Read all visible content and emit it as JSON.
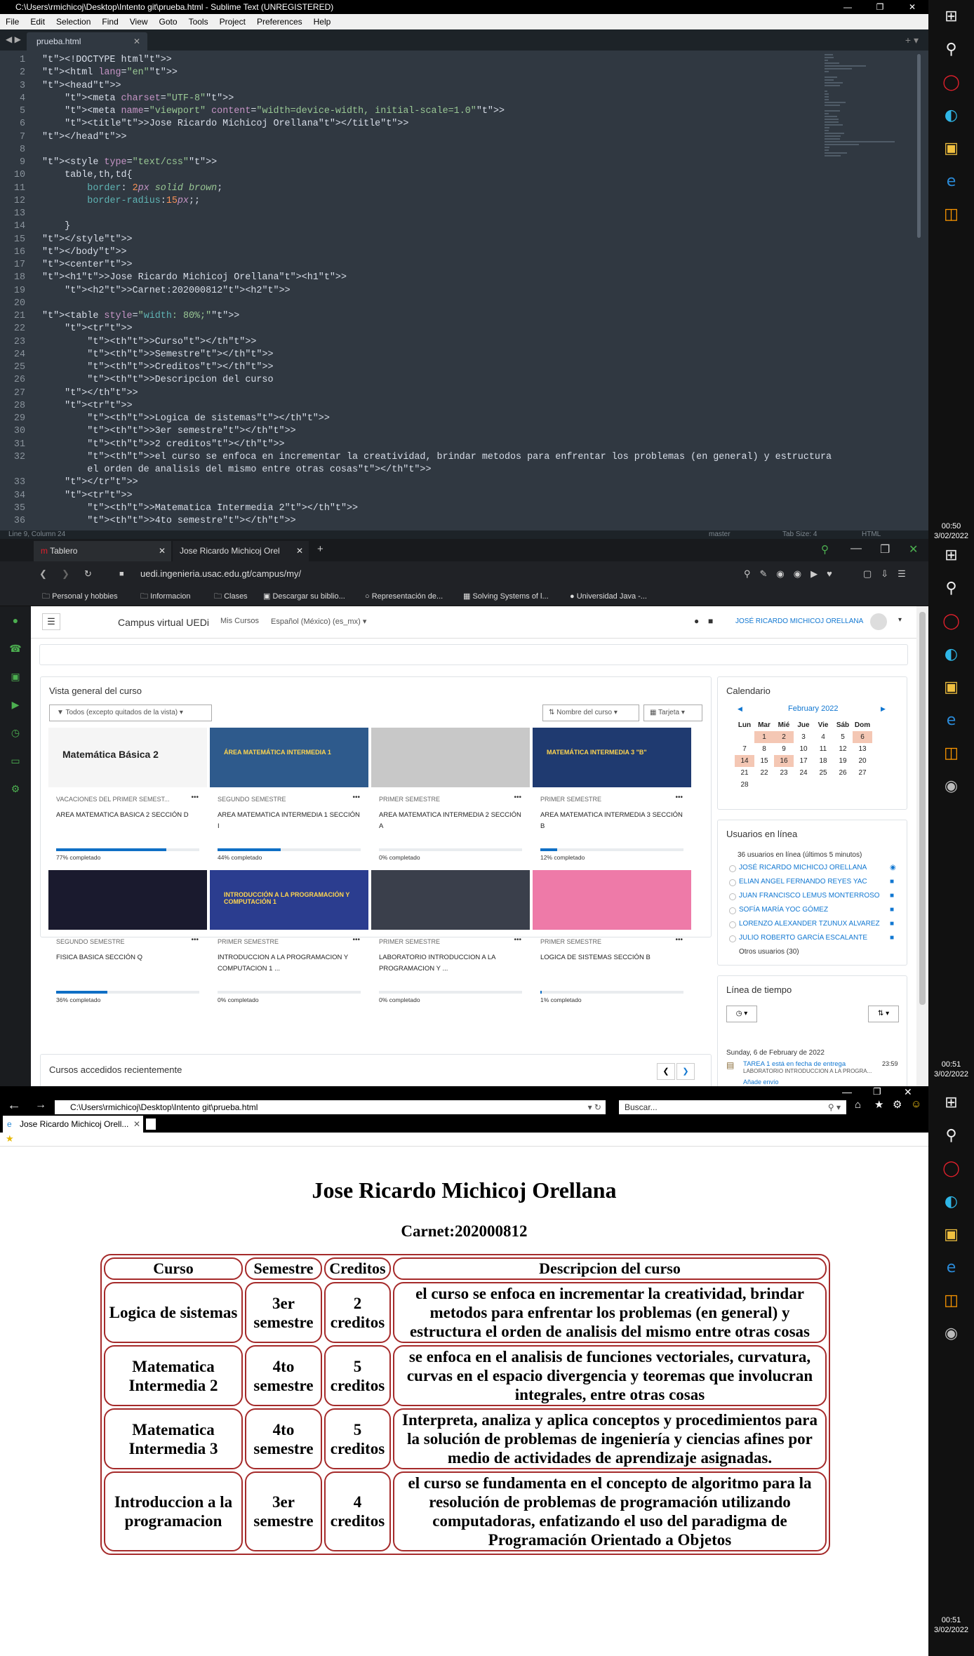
{
  "sublime": {
    "title": "C:\\Users\\rmichicoj\\Desktop\\Intento git\\prueba.html - Sublime Text (UNREGISTERED)",
    "menu": [
      "File",
      "Edit",
      "Selection",
      "Find",
      "View",
      "Goto",
      "Tools",
      "Project",
      "Preferences",
      "Help"
    ],
    "tab": "prueba.html",
    "status_left": "Line 9, Column 24",
    "status_branch": "master",
    "status_tab": "Tab Size: 4",
    "status_syntax": "HTML",
    "code_lines": [
      {
        "n": "1",
        "t": "<!DOCTYPE html>"
      },
      {
        "n": "2",
        "t": "<html lang=\"en\">"
      },
      {
        "n": "3",
        "t": "<head>"
      },
      {
        "n": "4",
        "t": "    <meta charset=\"UTF-8\">"
      },
      {
        "n": "5",
        "t": "    <meta name=\"viewport\" content=\"width=device-width, initial-scale=1.0\">"
      },
      {
        "n": "6",
        "t": "    <title>Jose Ricardo Michicoj Orellana</title>"
      },
      {
        "n": "7",
        "t": "</head>"
      },
      {
        "n": "8",
        "t": ""
      },
      {
        "n": "9",
        "t": "<style type=\"text/css\">"
      },
      {
        "n": "10",
        "t": "    table,th,td{"
      },
      {
        "n": "11",
        "t": "        border: 2px solid brown;"
      },
      {
        "n": "12",
        "t": "        border-radius:15px;;"
      },
      {
        "n": "13",
        "t": ""
      },
      {
        "n": "14",
        "t": "    }"
      },
      {
        "n": "15",
        "t": "</style>"
      },
      {
        "n": "16",
        "t": "</body>"
      },
      {
        "n": "17",
        "t": "<center>"
      },
      {
        "n": "18",
        "t": "<h1>Jose Ricardo Michicoj Orellana<h1>"
      },
      {
        "n": "19",
        "t": "    <h2>Carnet:202000812<h2>"
      },
      {
        "n": "20",
        "t": ""
      },
      {
        "n": "21",
        "t": "<table style=\"width: 80%;\">"
      },
      {
        "n": "22",
        "t": "    <tr>"
      },
      {
        "n": "23",
        "t": "        <th>Curso</th>"
      },
      {
        "n": "24",
        "t": "        <th>Semestre</th>"
      },
      {
        "n": "25",
        "t": "        <th>Creditos</th>"
      },
      {
        "n": "26",
        "t": "        <th>Descripcion del curso"
      },
      {
        "n": "27",
        "t": "    </th>"
      },
      {
        "n": "28",
        "t": "    <tr>"
      },
      {
        "n": "29",
        "t": "        <th>Logica de sistemas</th>"
      },
      {
        "n": "30",
        "t": "        <th>3er semestre</th>"
      },
      {
        "n": "31",
        "t": "        <th>2 creditos</th>"
      },
      {
        "n": "32",
        "t": "        <th>el curso se enfoca en incrementar la creatividad, brindar metodos para enfrentar los problemas (en general) y estructura"
      },
      {
        "n": "",
        "t": "        el orden de analisis del mismo entre otras cosas</th>"
      },
      {
        "n": "33",
        "t": "    </tr>"
      },
      {
        "n": "34",
        "t": "    <tr>"
      },
      {
        "n": "35",
        "t": "        <th>Matematica Intermedia 2</th>"
      },
      {
        "n": "36",
        "t": "        <th>4to semestre</th>"
      }
    ]
  },
  "taskbar": {
    "clock1_time": "00:50",
    "clock1_date": "3/02/2022",
    "clock2_time": "00:51",
    "clock2_date": "3/02/2022",
    "clock3_time": "00:51",
    "clock3_date": "3/02/2022"
  },
  "moodle_browser": {
    "tab1": "Tablero",
    "tab2": "Jose Ricardo Michicoj Orel",
    "url": "uedi.ingenieria.usac.edu.gt/campus/my/",
    "bookmarks": [
      "Personal y hobbies",
      "Informacion",
      "Clases",
      "Descargar su biblio...",
      "Representación de...",
      "Solving Systems of l...",
      "Universidad Java -..."
    ],
    "site_name": "Campus virtual UEDi",
    "nav_my_courses": "Mis Cursos",
    "nav_lang": "Español (México) (es_mx)",
    "user_name": "JOSÉ RICARDO MICHICOJ ORELLANA",
    "overview_title": "Vista general del curso",
    "filter_label": "Todos (excepto quitados de la vista)",
    "sort_label": "Nombre del curso",
    "view_label": "Tarjeta",
    "courses": [
      {
        "cat": "VACACIONES DEL PRIMER SEMEST...",
        "name": "AREA MATEMATICA BASICA 2 Sección D",
        "progress": "77% completado",
        "pct": 77,
        "img": "Matemática Básica 2"
      },
      {
        "cat": "SEGUNDO SEMESTRE",
        "name": "AREA MATEMATICA INTERMEDIA 1 Sección I",
        "progress": "44% completado",
        "pct": 44,
        "img": "ÁREA MATEMÁTICA INTERMEDIA 1"
      },
      {
        "cat": "PRIMER SEMESTRE",
        "name": "AREA MATEMATICA INTERMEDIA 2 Sección A",
        "progress": "0% completado",
        "pct": 0,
        "img": ""
      },
      {
        "cat": "PRIMER SEMESTRE",
        "name": "AREA MATEMATICA INTERMEDIA 3 Sección B",
        "progress": "12% completado",
        "pct": 12,
        "img": "MATEMÁTICA INTERMEDIA 3 \"B\""
      },
      {
        "cat": "SEGUNDO SEMESTRE",
        "name": "FISICA BASICA Sección Q",
        "progress": "36% completado",
        "pct": 36,
        "img": ""
      },
      {
        "cat": "PRIMER SEMESTRE",
        "name": "INTRODUCCION A LA PROGRAMACION Y COMPUTACION 1 ...",
        "progress": "0% completado",
        "pct": 0,
        "img": "INTRODUCCIÓN A LA PROGRAMACIÓN Y COMPUTACIÓN 1"
      },
      {
        "cat": "PRIMER SEMESTRE",
        "name": "LABORATORIO INTRODUCCION A LA PROGRAMACION Y ...",
        "progress": "0% completado",
        "pct": 0,
        "img": ""
      },
      {
        "cat": "PRIMER SEMESTRE",
        "name": "LOGICA DE SISTEMAS Sección B",
        "progress": "1% completado",
        "pct": 1,
        "img": ""
      }
    ],
    "recent_title": "Cursos accedidos recientemente",
    "calendar": {
      "title": "Calendario",
      "month": "February 2022",
      "days": [
        "Lun",
        "Mar",
        "Mié",
        "Jue",
        "Vie",
        "Sáb",
        "Dom"
      ],
      "weeks": [
        [
          "",
          "1",
          "2",
          "3",
          "4",
          "5",
          "6"
        ],
        [
          "7",
          "8",
          "9",
          "10",
          "11",
          "12",
          "13"
        ],
        [
          "14",
          "15",
          "16",
          "17",
          "18",
          "19",
          "20"
        ],
        [
          "21",
          "22",
          "23",
          "24",
          "25",
          "26",
          "27"
        ],
        [
          "28",
          "",
          "",
          "",
          "",
          "",
          ""
        ]
      ]
    },
    "online": {
      "title": "Usuarios en línea",
      "summary": "36 usuarios en línea (últimos 5 minutos)",
      "users": [
        "JOSÉ RICARDO MICHICOJ ORELLANA",
        "ELIAN ANGEL FERNANDO REYES YAC",
        "JUAN FRANCISCO LEMUS MONTERROSO",
        "SOFÍA MARÍA YOC GÓMEZ",
        "LORENZO ALEXANDER TZUNUX ALVAREZ",
        "JULIO ROBERTO GARCÍA ESCALANTE"
      ],
      "others": "Otros usuarios (30)"
    },
    "timeline": {
      "title": "Línea de tiempo",
      "date": "Sunday, 6 de February de 2022",
      "event": "TAREA 1 está en fecha de entrega",
      "event_course": "LABORATORIO INTRODUCCION A LA PROGRA...",
      "event_time": "23:59",
      "event_more": "Añade envío"
    }
  },
  "ie_browser": {
    "address": "C:\\Users\\rmichicoj\\Desktop\\Intento git\\prueba.html",
    "search_placeholder": "Buscar...",
    "tab": "Jose Ricardo Michicoj Orell...",
    "heading": "Jose Ricardo Michicoj Orellana",
    "carnet": "Carnet:202000812",
    "headers": [
      "Curso",
      "Semestre",
      "Creditos",
      "Descripcion del curso"
    ],
    "rows": [
      [
        "Logica de sistemas",
        "3er semestre",
        "2 creditos",
        "el curso se enfoca en incrementar la creatividad, brindar metodos para enfrentar los problemas (en general) y estructura el orden de analisis del mismo entre otras cosas"
      ],
      [
        "Matematica Intermedia 2",
        "4to semestre",
        "5 creditos",
        "se enfoca en el analisis de funciones vectoriales, curvatura, curvas en el espacio divergencia y teoremas que involucran integrales, entre otras cosas"
      ],
      [
        "Matematica Intermedia 3",
        "4to semestre",
        "5 creditos",
        "Interpreta, analiza y aplica conceptos y procedimientos para la solución de problemas de ingeniería y ciencias afines por medio de actividades de aprendizaje asignadas."
      ],
      [
        "Introduccion a la programacion",
        "3er semestre",
        "4 creditos",
        "el curso se fundamenta en el concepto de algoritmo para la resolución de problemas de programación utilizando computadoras, enfatizando el uso del paradigma de Programación Orientado a Objetos"
      ]
    ]
  }
}
